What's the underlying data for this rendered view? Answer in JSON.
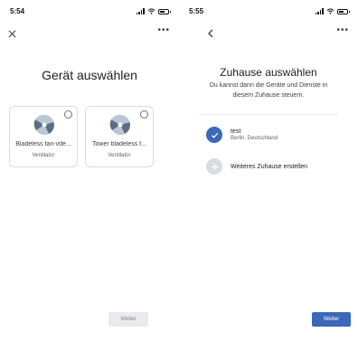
{
  "screen_left": {
    "status_time": "5:54",
    "title": "Gerät auswählen",
    "devices": [
      {
        "name": "Bladeless fan-vde...",
        "type": "Ventilator"
      },
      {
        "name": "Tower bladeless f...",
        "type": "Ventilator"
      }
    ],
    "next_button": "Weiter"
  },
  "screen_right": {
    "status_time": "5:55",
    "title": "Zuhause auswählen",
    "subtitle": "Du kannst dann die Geräte und Dienste in diesem Zuhause steuern.",
    "homes": [
      {
        "name": "test",
        "location": "Berlin, Deutschland",
        "selected": true
      }
    ],
    "create_home": "Weiteres Zuhause erstellen",
    "next_button": "Weiter"
  },
  "colors": {
    "accent": "#3b68b7",
    "fan_dark": "#5a6f86",
    "fan_light": "#b9c6d3",
    "disabled_bg": "#e8eaed"
  },
  "icons": {
    "close": "close-icon",
    "back": "back-arrow-icon",
    "more": "more-horizontal-icon",
    "fan": "fan-icon",
    "check": "check-icon",
    "plus": "plus-icon"
  }
}
